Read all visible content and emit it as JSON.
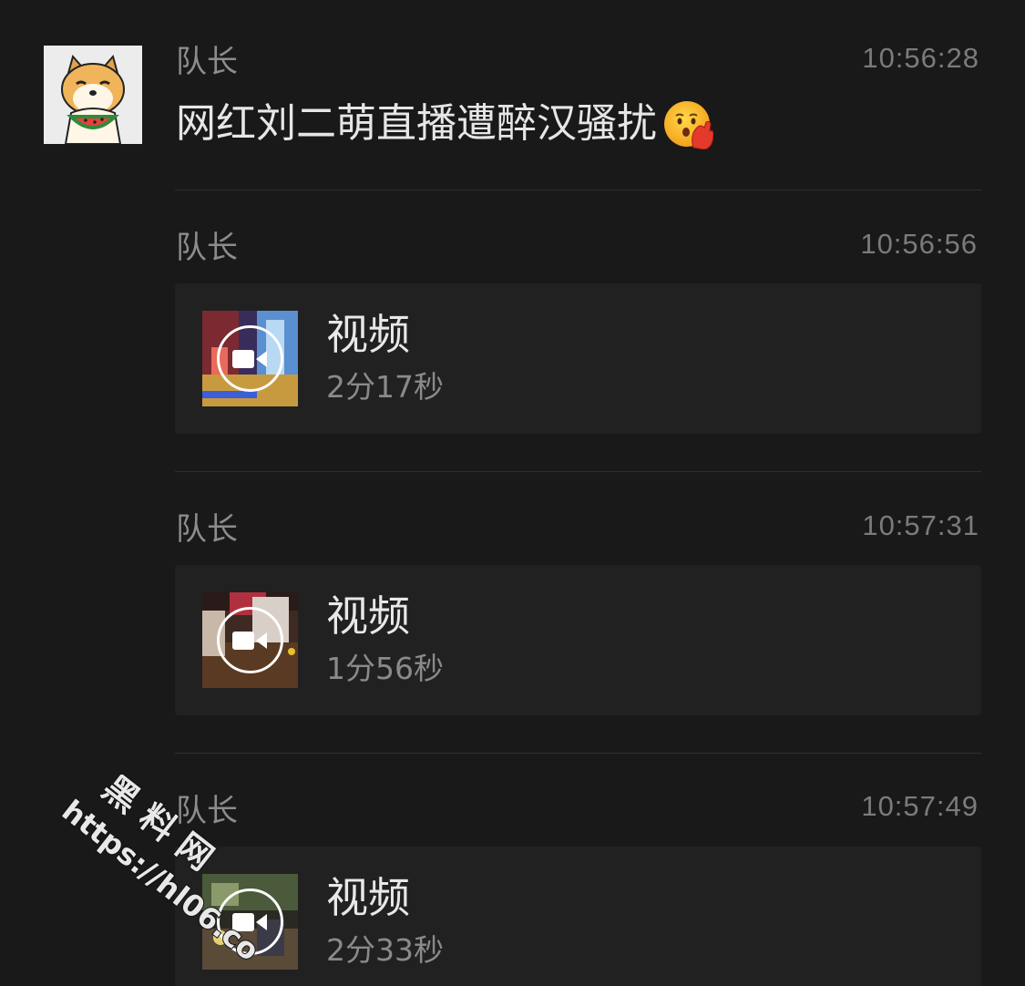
{
  "messages": [
    {
      "sender": "队长",
      "time": "10:56:28",
      "text": "网红刘二萌直播遭醉汉骚扰",
      "emoji": "face-with-hand-over-mouth-emoji"
    },
    {
      "sender": "队长",
      "time": "10:56:56",
      "video": {
        "title": "视频",
        "duration": "2分17秒"
      }
    },
    {
      "sender": "队长",
      "time": "10:57:31",
      "video": {
        "title": "视频",
        "duration": "1分56秒"
      }
    },
    {
      "sender": "队长",
      "time": "10:57:49",
      "video": {
        "title": "视频",
        "duration": "2分33秒"
      }
    }
  ],
  "watermark": {
    "line1": "黑 料 网",
    "line2": "https://hl06.co"
  },
  "colors": {
    "background": "#191919",
    "card": "#212121",
    "text_primary": "#e6e6e6",
    "text_secondary": "#8c8c8c"
  }
}
